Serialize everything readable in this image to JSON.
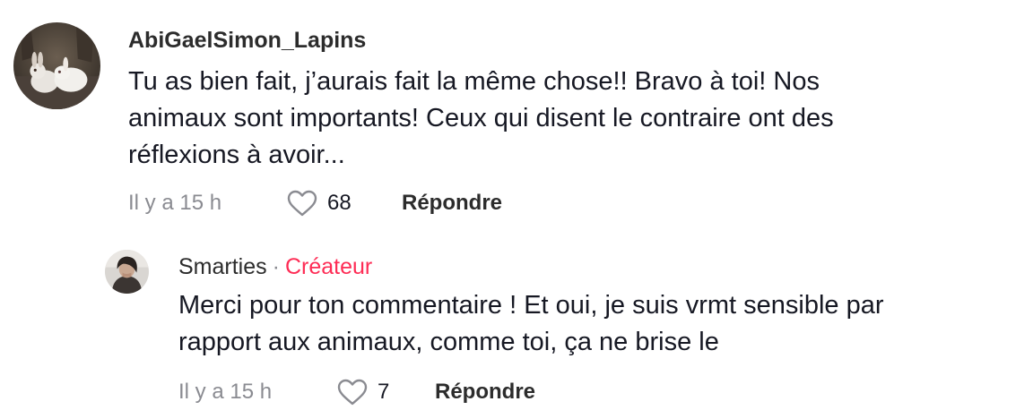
{
  "comment": {
    "username": "AbiGaelSimon_Lapins",
    "text_lines": [
      "Tu as bien fait, j’aurais fait la même chose!! Bravo à toi! Nos",
      "animaux sont importants! Ceux qui disent le contraire ont des",
      "réflexions à avoir..."
    ],
    "time": "Il y a 15 h",
    "likes": "68",
    "reply_label": "Répondre",
    "avatar_icon": "rabbits-avatar-icon",
    "like_icon": "heart-outline-icon"
  },
  "reply": {
    "username": "Smarties",
    "separator": "·",
    "badge": "Créateur",
    "badge_color": "#fe2c55",
    "text_lines": [
      "Merci pour ton commentaire ! Et oui, je suis vrmt sensible par",
      "rapport aux animaux, comme toi, ça ne brise le"
    ],
    "time": "Il y a 15 h",
    "likes": "7",
    "reply_label": "Répondre",
    "avatar_icon": "user-photo-avatar-icon",
    "like_icon": "heart-outline-icon"
  }
}
